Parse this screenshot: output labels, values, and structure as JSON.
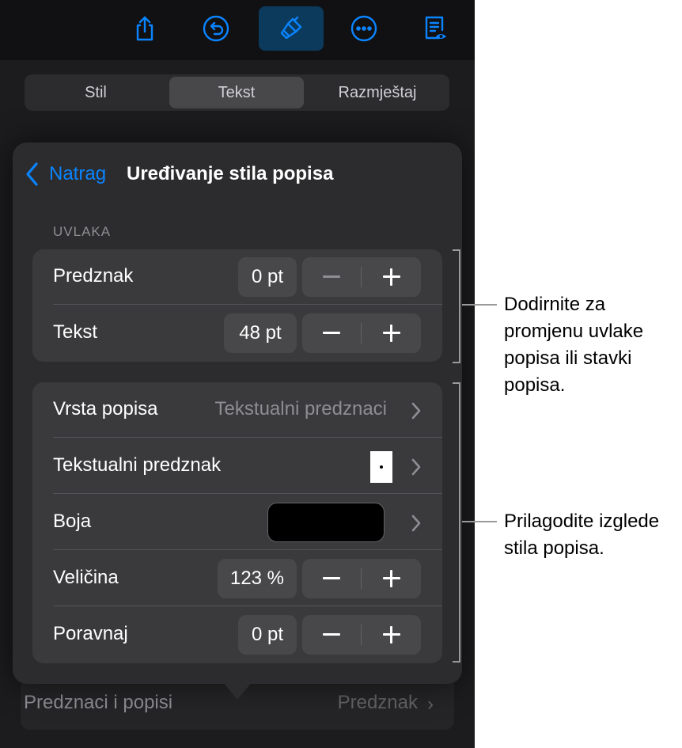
{
  "toolbar": {
    "buttons": [
      {
        "name": "share-icon"
      },
      {
        "name": "undo-icon"
      },
      {
        "name": "format-brush-icon",
        "active": true
      },
      {
        "name": "more-icon"
      },
      {
        "name": "reading-view-icon"
      }
    ]
  },
  "tabs": [
    "Stil",
    "Tekst",
    "Razmještaj"
  ],
  "selected_tab": "Tekst",
  "popover": {
    "back_label": "Natrag",
    "title": "Uređivanje stila popisa",
    "indent_section": "UVLAKA",
    "indent_rows": [
      {
        "label": "Predznak",
        "value": "0 pt"
      },
      {
        "label": "Tekst",
        "value": "48 pt"
      }
    ],
    "style_rows": {
      "list_type_label": "Vrsta popisa",
      "list_type_value": "Tekstualni predznaci",
      "text_bullet_label": "Tekstualni predznak",
      "text_bullet_value": "•",
      "color_label": "Boja",
      "color_value": "#000000",
      "size_label": "Veličina",
      "size_value": "123 %",
      "align_label": "Poravnaj",
      "align_value": "0 pt"
    }
  },
  "background_row": {
    "label": "Predznaci i popisi",
    "value": "Predznak"
  },
  "callouts": {
    "indent": "Dodirnite za promjenu uvlake popisa ili stavki popisa.",
    "style": "Prilagodite izglede stila popisa."
  },
  "colors": {
    "accent": "#0a84ff",
    "active_tool": "#0b3a5c"
  }
}
